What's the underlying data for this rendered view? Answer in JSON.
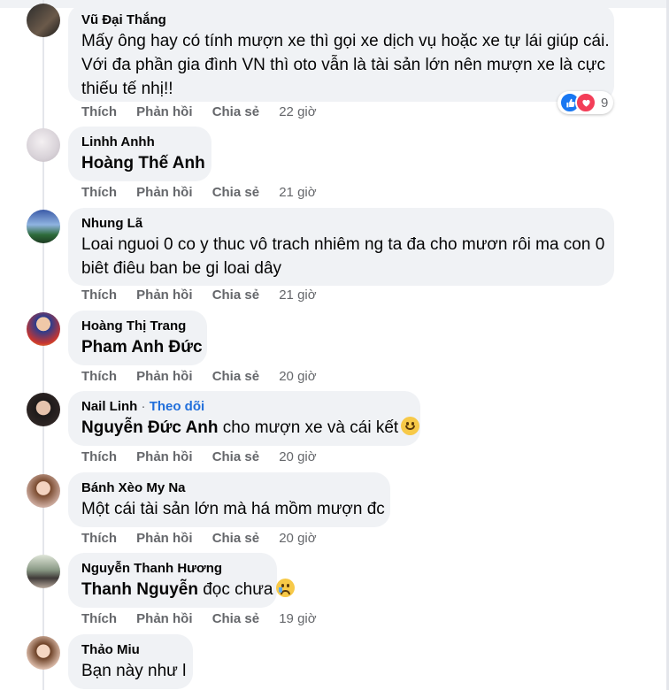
{
  "colors": {
    "bubble": "#f0f2f5",
    "meta": "#65676b",
    "link": "#216fdb",
    "like": "#1877f2",
    "love": "#f33e58"
  },
  "comments": [
    {
      "author": "Vũ Đại Thắng",
      "lines": [
        "Mấy ông hay có tính mượn xe thì gọi xe dịch vụ hoặc xe tự lái giúp cái.",
        "Với đa phần gia đình VN thì oto vẫn là tài sản lớn nên mượn xe là cực",
        "thiếu tế nhị!!"
      ],
      "like": "Thích",
      "reply": "Phản hồi",
      "share": "Chia sẻ",
      "time": "22 giờ",
      "reactions": {
        "icons": [
          "like-icon",
          "love-icon"
        ],
        "count": "9"
      }
    },
    {
      "author": "Linhh Anhh",
      "mention": "Hoàng Thế Anh",
      "like": "Thích",
      "reply": "Phản hồi",
      "share": "Chia sẻ",
      "time": "21 giờ"
    },
    {
      "author": "Nhung Lã",
      "lines": [
        "Loai nguoi 0 co y thuc vô trach nhiêm ng ta đa cho mươn rôi ma con 0",
        "biêt điêu ban be gi loai dây"
      ],
      "like": "Thích",
      "reply": "Phản hồi",
      "share": "Chia sẻ",
      "time": "21 giờ"
    },
    {
      "author": "Hoàng Thị Trang",
      "mention": "Pham Anh Đức",
      "like": "Thích",
      "reply": "Phản hồi",
      "share": "Chia sẻ",
      "time": "20 giờ"
    },
    {
      "author": "Nail Linh",
      "follow": "Theo dõi",
      "separator": "·",
      "mention": "Nguyễn Đức Anh",
      "text": "cho mượn xe và cái kết",
      "emoji": "grinning-face-emoji",
      "like": "Thích",
      "reply": "Phản hồi",
      "share": "Chia sẻ",
      "time": "20 giờ"
    },
    {
      "author": "Bánh Xèo My Na",
      "text": "Một cái tài sản lớn mà há mồm mượn đc",
      "like": "Thích",
      "reply": "Phản hồi",
      "share": "Chia sẻ",
      "time": "20 giờ"
    },
    {
      "author": "Nguyễn Thanh Hương",
      "mention": "Thanh Nguyễn",
      "text": "đọc chưa",
      "emoji": "sad-tear-face-emoji",
      "like": "Thích",
      "reply": "Phản hồi",
      "share": "Chia sẻ",
      "time": "19 giờ"
    },
    {
      "author": "Thảo Miu",
      "text": "Bạn này như l"
    }
  ]
}
